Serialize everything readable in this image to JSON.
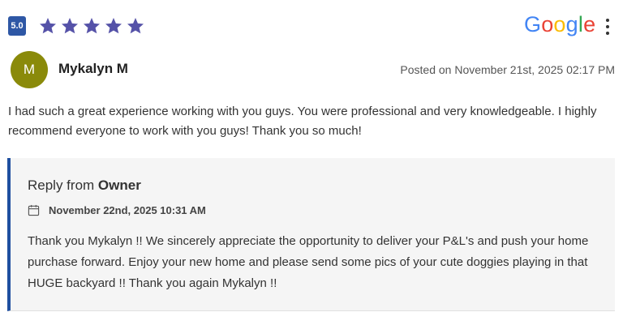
{
  "header": {
    "rating_value": "5.0",
    "star_count": 5,
    "star_color": "#5552a8",
    "badge_color": "#2e57a5",
    "source_logo": [
      "G",
      "o",
      "o",
      "g",
      "l",
      "e"
    ],
    "source_logo_colors": [
      "#4285F4",
      "#EA4335",
      "#FBBC05",
      "#4285F4",
      "#34A853",
      "#EA4335"
    ],
    "more_icon": "more-vertical-icon"
  },
  "reviewer": {
    "avatar_initial": "M",
    "avatar_color": "#8a8a0a",
    "name": "Mykalyn M",
    "posted": "Posted on November 21st, 2025 02:17 PM"
  },
  "review": {
    "text": "I had such a great experience working with you guys. You were professional and very knowledgeable. I highly recommend everyone to work with you guys! Thank you so much!"
  },
  "reply": {
    "prefix": "Reply from ",
    "author": "Owner",
    "calendar_icon": "calendar-icon",
    "date": "November 22nd, 2025 10:31 AM",
    "text": "Thank you Mykalyn !! We sincerely appreciate the opportunity to deliver your P&L's and push your home purchase forward. Enjoy your new home and please send some pics of your cute doggies playing in that HUGE backyard !! Thank you again Mykalyn !!",
    "accent_color": "#1f4fa0"
  }
}
